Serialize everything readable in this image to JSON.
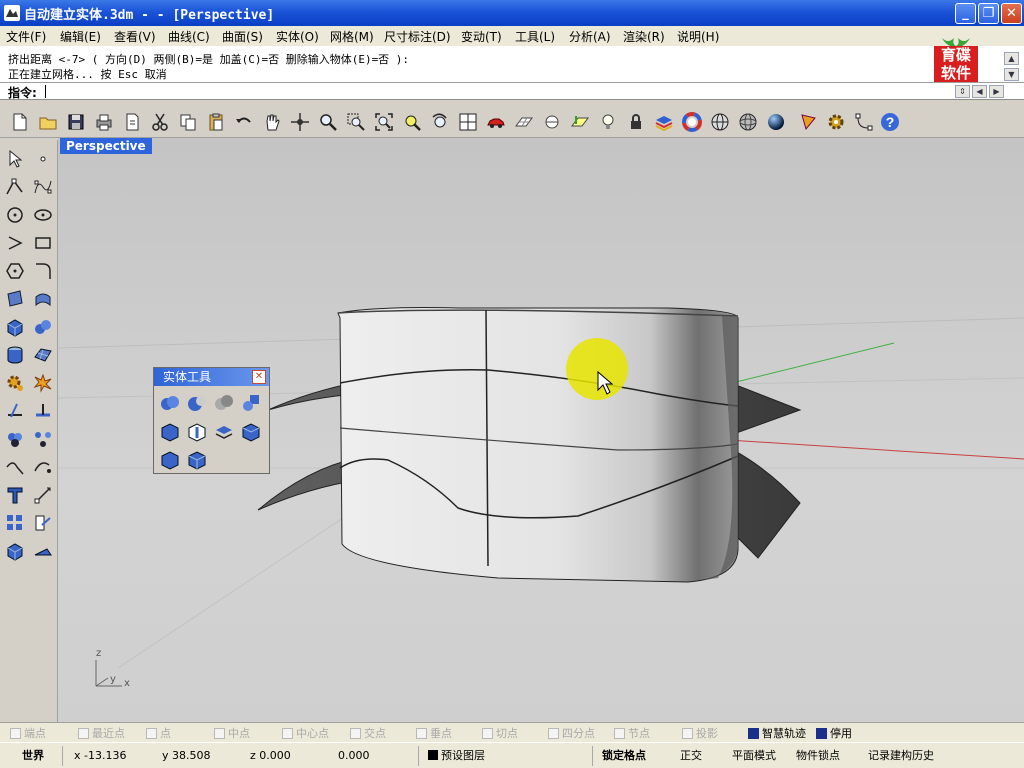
{
  "window": {
    "title": "自动建立实体.3dm - - [Perspective]",
    "minimize": "_",
    "restore": "❐",
    "close": "✕"
  },
  "menu": [
    "文件(F)",
    "编辑(E)",
    "查看(V)",
    "曲线(C)",
    "曲面(S)",
    "实体(O)",
    "网格(M)",
    "尺寸标注(D)",
    "变动(T)",
    "工具(L)",
    "分析(A)",
    "渲染(R)",
    "说明(H)"
  ],
  "command": {
    "history_line1": "挤出距离 <-7> ( 方向(D)  两侧(B)=是  加盖(C)=否  删除输入物体(E)=否 ):",
    "history_line2": "正在建立网格... 按 Esc 取消",
    "prompt": "指令:",
    "input_value": ""
  },
  "logo": {
    "line1": "育碟",
    "line2": "软件"
  },
  "toolbar_icons": [
    "new-icon",
    "open-icon",
    "save-icon",
    "print-icon",
    "import-icon",
    "cut-icon",
    "copy-icon",
    "paste-icon",
    "undo-icon",
    "pan-icon",
    "rotate-view-icon",
    "zoom-icon",
    "zoom-window-icon",
    "zoom-extents-icon",
    "zoom-selected-icon",
    "undo-view-icon",
    "four-viewports-icon",
    "car-icon",
    "grid-icon",
    "cplane-icon",
    "set-cplane-icon",
    "light-icon",
    "lock-icon",
    "layers-icon",
    "color-wheel-icon",
    "wireframe-sphere-icon",
    "shaded-sphere-icon",
    "rendered-sphere-icon",
    "cone-icon",
    "gear-icon",
    "point-edit-icon",
    "help-icon"
  ],
  "viewport": {
    "label": "Perspective",
    "axis_z": "z",
    "axis_x": "x",
    "axis_y": "y"
  },
  "solid_palette": {
    "title": "实体工具",
    "close": "✕"
  },
  "osnaps": [
    {
      "label": "端点",
      "on": false
    },
    {
      "label": "最近点",
      "on": false
    },
    {
      "label": "点",
      "on": false
    },
    {
      "label": "中点",
      "on": false
    },
    {
      "label": "中心点",
      "on": false
    },
    {
      "label": "交点",
      "on": false
    },
    {
      "label": "垂点",
      "on": false
    },
    {
      "label": "切点",
      "on": false
    },
    {
      "label": "四分点",
      "on": false
    },
    {
      "label": "节点",
      "on": false
    },
    {
      "label": "投影",
      "on": false
    },
    {
      "label": "智慧轨迹",
      "on": true
    },
    {
      "label": "停用",
      "on": true
    }
  ],
  "status": {
    "coord_system": "世界",
    "x": "x -13.136",
    "y": "y 38.508",
    "z": "z 0.000",
    "distance": "0.000",
    "layer": "预设图层",
    "snap": "锁定格点",
    "ortho": "正交",
    "planar": "平面模式",
    "osnap": "物件锁点",
    "history": "记录建构历史"
  }
}
